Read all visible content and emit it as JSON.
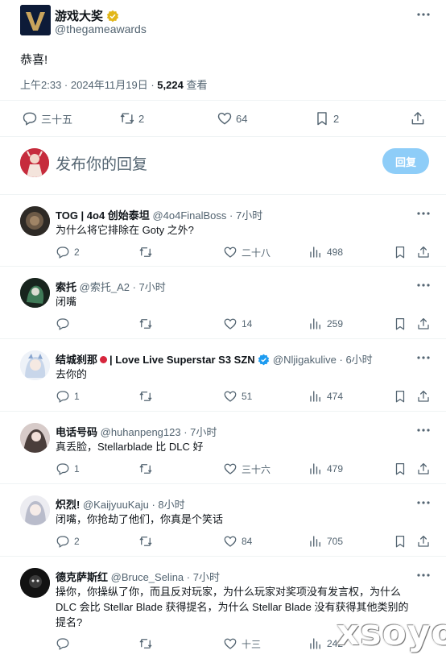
{
  "main_post": {
    "display_name": "游戏大奖",
    "handle": "@thegameawards",
    "text": "恭喜!",
    "time": "上午2:33 · 2024年11月19日 · ",
    "views_count": "5,224",
    "views_label": " 查看",
    "replies": "三十五",
    "retweets": "2",
    "likes": "64",
    "bookmarks": "2"
  },
  "compose": {
    "placeholder": "发布你的回复",
    "button_label": "回复"
  },
  "replies": [
    {
      "name": "TOG | 4o4 创始泰坦",
      "handle": "@4o4FinalBoss",
      "time": "· 7小时",
      "text": "为什么将它排除在 Goty 之外?",
      "replies": "2",
      "retweets": "",
      "likes": "二十八",
      "views": "498"
    },
    {
      "name": "索托",
      "handle": "@索托_A2",
      "time": "· 7小时",
      "text": "闭嘴",
      "replies": "",
      "retweets": "",
      "likes": "14",
      "views": "259"
    },
    {
      "name_part1": "结城刹那",
      "name_part2": "| Love Live Superstar S3 SZN",
      "handle": "@Nljigakulive",
      "time": "· 6小时",
      "text": "去你的",
      "replies": "1",
      "retweets": "",
      "likes": "51",
      "views": "474"
    },
    {
      "name": "电话号码",
      "handle": "@huhanpeng123",
      "time": "· 7小时",
      "text": "真丢脸，Stellarblade 比 DLC 好",
      "replies": "1",
      "retweets": "",
      "likes": "三十六",
      "views": "479"
    },
    {
      "name": "炽烈!",
      "handle": "@KaijyuuKaju",
      "time": "· 8小时",
      "text": "闭嘴，你抢劫了他们，你真是个笑话",
      "replies": "2",
      "retweets": "",
      "likes": "84",
      "views": "705"
    },
    {
      "name": "德克萨斯红",
      "handle": "@Bruce_Selina",
      "time": "· 7小时",
      "text_line1": "操你，你操纵了你，而且反对玩家，为什么玩家对奖项没有发言权，为什么",
      "text_line2": "DLC 会比 Stellar Blade 获得提名，为什么 Stellar Blade 没有获得其他类别的",
      "text_line3": "提名?",
      "replies": "",
      "retweets": "",
      "likes": "十三",
      "views": "242"
    }
  ],
  "watermark": "xsoyo",
  "colors": {
    "text_primary": "#0f1419",
    "text_secondary": "#536471",
    "reply_button": "#8ecdf8",
    "verified_gold": "#e2b719",
    "verified_blue": "#1d9bf0",
    "divider": "#eff3f4"
  }
}
